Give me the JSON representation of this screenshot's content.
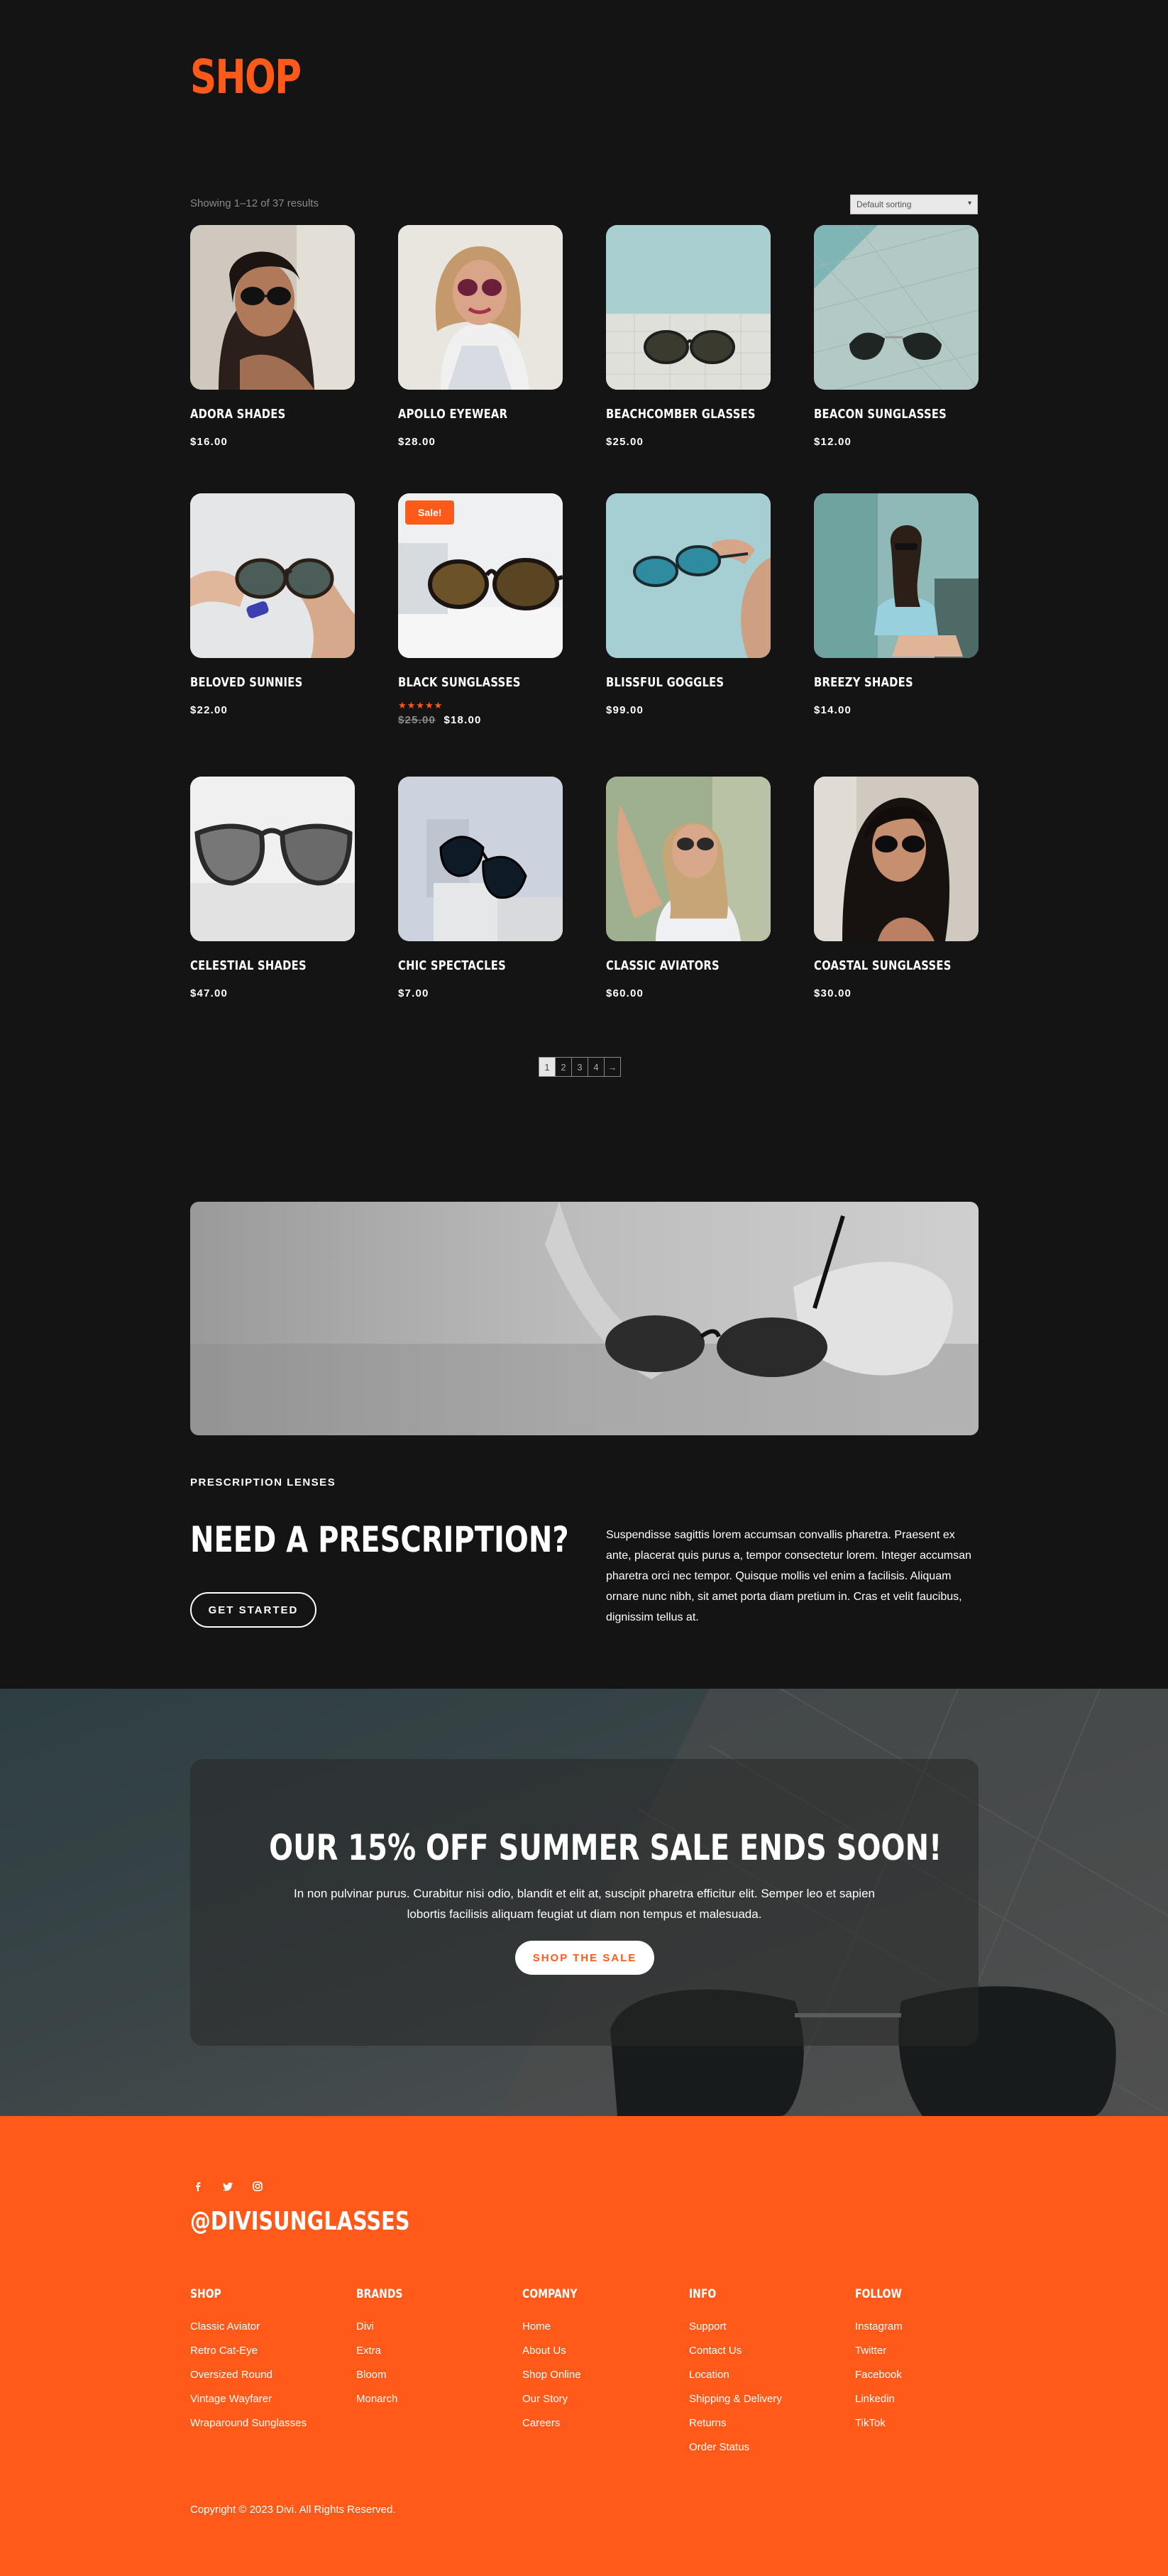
{
  "shop": {
    "title": "SHOP",
    "result_count": "Showing 1–12 of 37 results",
    "sort_value": "Default sorting",
    "products": [
      {
        "name": "ADORA SHADES",
        "price": "$16.00"
      },
      {
        "name": "APOLLO EYEWEAR",
        "price": "$28.00"
      },
      {
        "name": "BEACHCOMBER GLASSES",
        "price": "$25.00"
      },
      {
        "name": "BEACON SUNGLASSES",
        "price": "$12.00"
      },
      {
        "name": "BELOVED SUNNIES",
        "price": "$22.00"
      },
      {
        "name": "BLACK SUNGLASSES",
        "price": "$18.00",
        "old_price": "$25.00",
        "badge": "Sale!",
        "rating": "★★★★★"
      },
      {
        "name": "BLISSFUL GOGGLES",
        "price": "$99.00"
      },
      {
        "name": "BREEZY SHADES",
        "price": "$14.00"
      },
      {
        "name": "CELESTIAL SHADES",
        "price": "$47.00"
      },
      {
        "name": "CHIC SPECTACLES",
        "price": "$7.00"
      },
      {
        "name": "CLASSIC AVIATORS",
        "price": "$60.00"
      },
      {
        "name": "COASTAL SUNGLASSES",
        "price": "$30.00"
      }
    ],
    "pagination": [
      "1",
      "2",
      "3",
      "4",
      "→"
    ]
  },
  "prescription": {
    "eyebrow": "PRESCRIPTION LENSES",
    "heading": "NEED A PRESCRIPTION?",
    "button": "GET STARTED",
    "body": "Suspendisse sagittis lorem accumsan convallis pharetra. Praesent ex ante, placerat quis purus a, tempor consectetur lorem. Integer accumsan pharetra orci nec tempor. Quisque mollis vel enim a facilisis. Aliquam ornare nunc nibh, sit amet porta diam pretium in. Cras et velit faucibus, dignissim tellus at."
  },
  "sale": {
    "heading": "OUR 15% OFF SUMMER SALE ENDS SOON!",
    "text": "In non pulvinar purus. Curabitur nisi odio, blandit et elit at, suscipit pharetra efficitur elit. Semper leo et sapien lobortis facilisis aliquam feugiat ut diam non tempus et malesuada.",
    "button": "SHOP THE SALE"
  },
  "footer": {
    "socials": [
      "facebook-icon",
      "twitter-icon",
      "instagram-icon"
    ],
    "handle": "@DIVISUNGLASSES",
    "columns": [
      {
        "heading": "SHOP",
        "links": [
          "Classic Aviator",
          "Retro Cat-Eye",
          "Oversized Round",
          "Vintage Wayfarer",
          "Wraparound Sunglasses"
        ]
      },
      {
        "heading": "BRANDS",
        "links": [
          "Divi",
          "Extra",
          "Bloom",
          "Monarch"
        ]
      },
      {
        "heading": "COMPANY",
        "links": [
          "Home",
          "About Us",
          "Shop Online",
          "Our Story",
          "Careers"
        ]
      },
      {
        "heading": "INFO",
        "links": [
          "Support",
          "Contact Us",
          "Location",
          "Shipping & Delivery",
          "Returns",
          "Order Status"
        ]
      },
      {
        "heading": "FOLLOW",
        "links": [
          "Instagram",
          "Twitter",
          "Facebook",
          "Linkedin",
          "TikTok"
        ]
      }
    ],
    "copyright": "Copyright © 2023 Divi. All Rights Reserved."
  },
  "colors": {
    "accent": "#ff5a1a",
    "background": "#141414",
    "text": "#ffffff"
  }
}
